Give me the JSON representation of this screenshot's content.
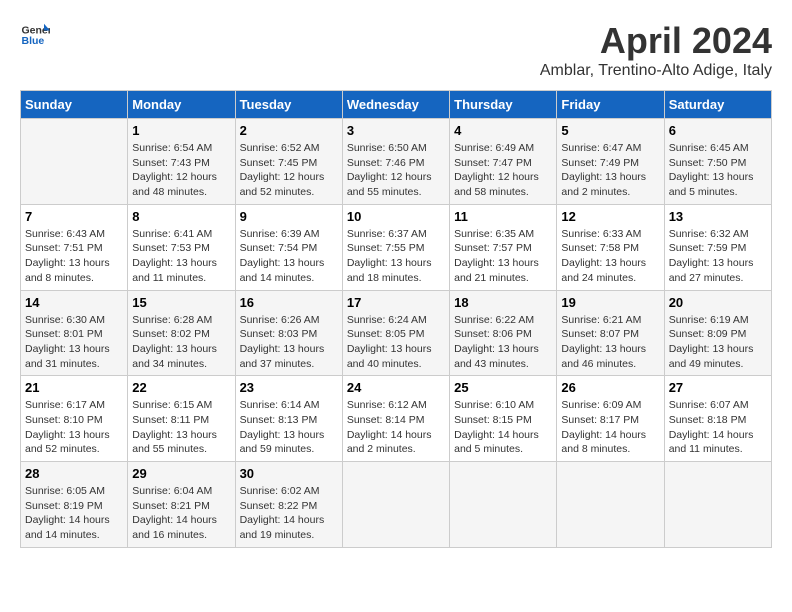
{
  "header": {
    "logo_line1": "General",
    "logo_line2": "Blue",
    "month": "April 2024",
    "location": "Amblar, Trentino-Alto Adige, Italy"
  },
  "columns": [
    "Sunday",
    "Monday",
    "Tuesday",
    "Wednesday",
    "Thursday",
    "Friday",
    "Saturday"
  ],
  "weeks": [
    [
      {
        "num": "",
        "info": ""
      },
      {
        "num": "1",
        "info": "Sunrise: 6:54 AM\nSunset: 7:43 PM\nDaylight: 12 hours\nand 48 minutes."
      },
      {
        "num": "2",
        "info": "Sunrise: 6:52 AM\nSunset: 7:45 PM\nDaylight: 12 hours\nand 52 minutes."
      },
      {
        "num": "3",
        "info": "Sunrise: 6:50 AM\nSunset: 7:46 PM\nDaylight: 12 hours\nand 55 minutes."
      },
      {
        "num": "4",
        "info": "Sunrise: 6:49 AM\nSunset: 7:47 PM\nDaylight: 12 hours\nand 58 minutes."
      },
      {
        "num": "5",
        "info": "Sunrise: 6:47 AM\nSunset: 7:49 PM\nDaylight: 13 hours\nand 2 minutes."
      },
      {
        "num": "6",
        "info": "Sunrise: 6:45 AM\nSunset: 7:50 PM\nDaylight: 13 hours\nand 5 minutes."
      }
    ],
    [
      {
        "num": "7",
        "info": "Sunrise: 6:43 AM\nSunset: 7:51 PM\nDaylight: 13 hours\nand 8 minutes."
      },
      {
        "num": "8",
        "info": "Sunrise: 6:41 AM\nSunset: 7:53 PM\nDaylight: 13 hours\nand 11 minutes."
      },
      {
        "num": "9",
        "info": "Sunrise: 6:39 AM\nSunset: 7:54 PM\nDaylight: 13 hours\nand 14 minutes."
      },
      {
        "num": "10",
        "info": "Sunrise: 6:37 AM\nSunset: 7:55 PM\nDaylight: 13 hours\nand 18 minutes."
      },
      {
        "num": "11",
        "info": "Sunrise: 6:35 AM\nSunset: 7:57 PM\nDaylight: 13 hours\nand 21 minutes."
      },
      {
        "num": "12",
        "info": "Sunrise: 6:33 AM\nSunset: 7:58 PM\nDaylight: 13 hours\nand 24 minutes."
      },
      {
        "num": "13",
        "info": "Sunrise: 6:32 AM\nSunset: 7:59 PM\nDaylight: 13 hours\nand 27 minutes."
      }
    ],
    [
      {
        "num": "14",
        "info": "Sunrise: 6:30 AM\nSunset: 8:01 PM\nDaylight: 13 hours\nand 31 minutes."
      },
      {
        "num": "15",
        "info": "Sunrise: 6:28 AM\nSunset: 8:02 PM\nDaylight: 13 hours\nand 34 minutes."
      },
      {
        "num": "16",
        "info": "Sunrise: 6:26 AM\nSunset: 8:03 PM\nDaylight: 13 hours\nand 37 minutes."
      },
      {
        "num": "17",
        "info": "Sunrise: 6:24 AM\nSunset: 8:05 PM\nDaylight: 13 hours\nand 40 minutes."
      },
      {
        "num": "18",
        "info": "Sunrise: 6:22 AM\nSunset: 8:06 PM\nDaylight: 13 hours\nand 43 minutes."
      },
      {
        "num": "19",
        "info": "Sunrise: 6:21 AM\nSunset: 8:07 PM\nDaylight: 13 hours\nand 46 minutes."
      },
      {
        "num": "20",
        "info": "Sunrise: 6:19 AM\nSunset: 8:09 PM\nDaylight: 13 hours\nand 49 minutes."
      }
    ],
    [
      {
        "num": "21",
        "info": "Sunrise: 6:17 AM\nSunset: 8:10 PM\nDaylight: 13 hours\nand 52 minutes."
      },
      {
        "num": "22",
        "info": "Sunrise: 6:15 AM\nSunset: 8:11 PM\nDaylight: 13 hours\nand 55 minutes."
      },
      {
        "num": "23",
        "info": "Sunrise: 6:14 AM\nSunset: 8:13 PM\nDaylight: 13 hours\nand 59 minutes."
      },
      {
        "num": "24",
        "info": "Sunrise: 6:12 AM\nSunset: 8:14 PM\nDaylight: 14 hours\nand 2 minutes."
      },
      {
        "num": "25",
        "info": "Sunrise: 6:10 AM\nSunset: 8:15 PM\nDaylight: 14 hours\nand 5 minutes."
      },
      {
        "num": "26",
        "info": "Sunrise: 6:09 AM\nSunset: 8:17 PM\nDaylight: 14 hours\nand 8 minutes."
      },
      {
        "num": "27",
        "info": "Sunrise: 6:07 AM\nSunset: 8:18 PM\nDaylight: 14 hours\nand 11 minutes."
      }
    ],
    [
      {
        "num": "28",
        "info": "Sunrise: 6:05 AM\nSunset: 8:19 PM\nDaylight: 14 hours\nand 14 minutes."
      },
      {
        "num": "29",
        "info": "Sunrise: 6:04 AM\nSunset: 8:21 PM\nDaylight: 14 hours\nand 16 minutes."
      },
      {
        "num": "30",
        "info": "Sunrise: 6:02 AM\nSunset: 8:22 PM\nDaylight: 14 hours\nand 19 minutes."
      },
      {
        "num": "",
        "info": ""
      },
      {
        "num": "",
        "info": ""
      },
      {
        "num": "",
        "info": ""
      },
      {
        "num": "",
        "info": ""
      }
    ]
  ]
}
